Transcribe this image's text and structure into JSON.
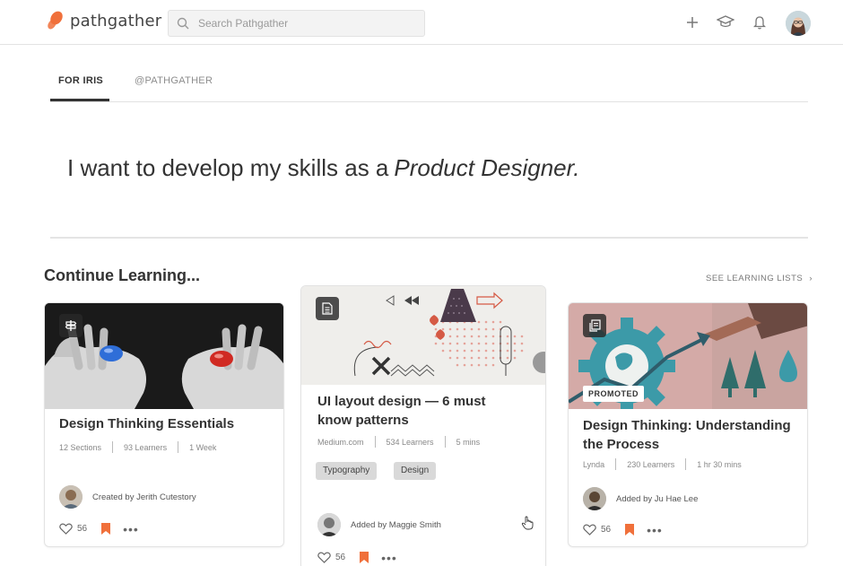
{
  "app": {
    "name": "pathgather",
    "brand_color": "#f0703b"
  },
  "search": {
    "placeholder": "Search Pathgather"
  },
  "nav": {
    "icons": [
      "plus-icon",
      "graduation-cap-icon",
      "bell-icon"
    ]
  },
  "tabs": [
    {
      "label": "FOR IRIS",
      "active": true
    },
    {
      "label": "@PATHGATHER",
      "active": false
    }
  ],
  "hero": {
    "prefix": "I want to develop my skills as a",
    "role": "Product Designer."
  },
  "section": {
    "title": "Continue Learning...",
    "see_all": "SEE LEARNING LISTS"
  },
  "cards": [
    {
      "type_icon": "signpost-icon",
      "title": "Design Thinking Essentials",
      "meta": [
        "12 Sections",
        "93 Learners",
        "1 Week"
      ],
      "author": "Created by Jerith Cutestory",
      "likes": "56"
    },
    {
      "type_icon": "document-icon",
      "title": "UI layout design — 6 must know patterns",
      "meta": [
        "Medium.com",
        "534 Learners",
        "5 mins"
      ],
      "tags": [
        "Typography",
        "Design"
      ],
      "author": "Added by Maggie Smith",
      "likes": "56"
    },
    {
      "type_icon": "copy-icon",
      "badge": "PROMOTED",
      "title": "Design Thinking: Understanding the Process",
      "meta": [
        "Lynda",
        "230 Learners",
        "1 hr 30 mins"
      ],
      "author": "Added by Ju Hae Lee",
      "likes": "56"
    }
  ]
}
